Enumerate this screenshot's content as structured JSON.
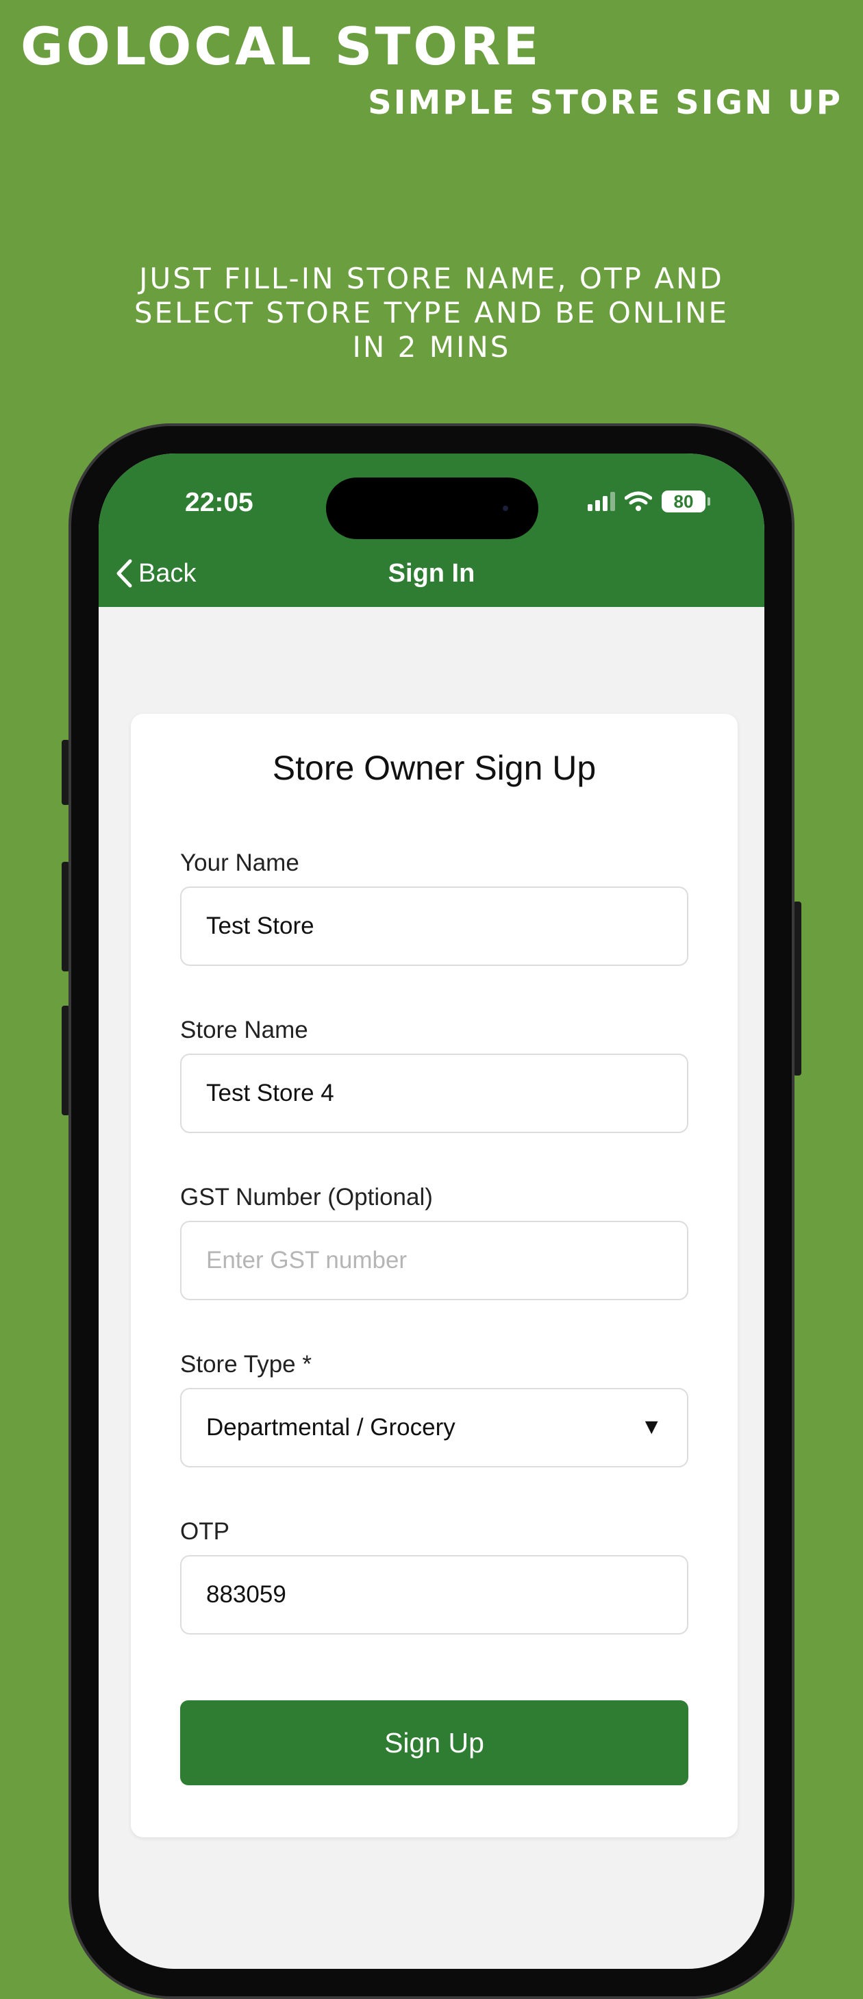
{
  "banner": {
    "brand": "GOLOCAL STORE",
    "tagline": "SIMPLE STORE SIGN UP",
    "promo": "JUST FILL-IN STORE NAME, OTP AND SELECT STORE TYPE AND BE ONLINE IN 2 MINS"
  },
  "status_bar": {
    "time": "22:05",
    "battery": "80"
  },
  "nav": {
    "back_label": "Back",
    "title": "Sign In"
  },
  "form": {
    "title": "Store Owner Sign Up",
    "your_name": {
      "label": "Your Name",
      "value": "Test Store"
    },
    "store_name": {
      "label": "Store Name",
      "value": "Test Store 4"
    },
    "gst_number": {
      "label": "GST Number (Optional)",
      "value": "",
      "placeholder": "Enter GST number"
    },
    "store_type": {
      "label": "Store Type *",
      "value": "Departmental / Grocery"
    },
    "otp": {
      "label": "OTP",
      "value": "883059"
    },
    "submit_label": "Sign Up"
  },
  "colors": {
    "background": "#6a9e3e",
    "header": "#2e7d32",
    "button": "#2e7d32"
  }
}
